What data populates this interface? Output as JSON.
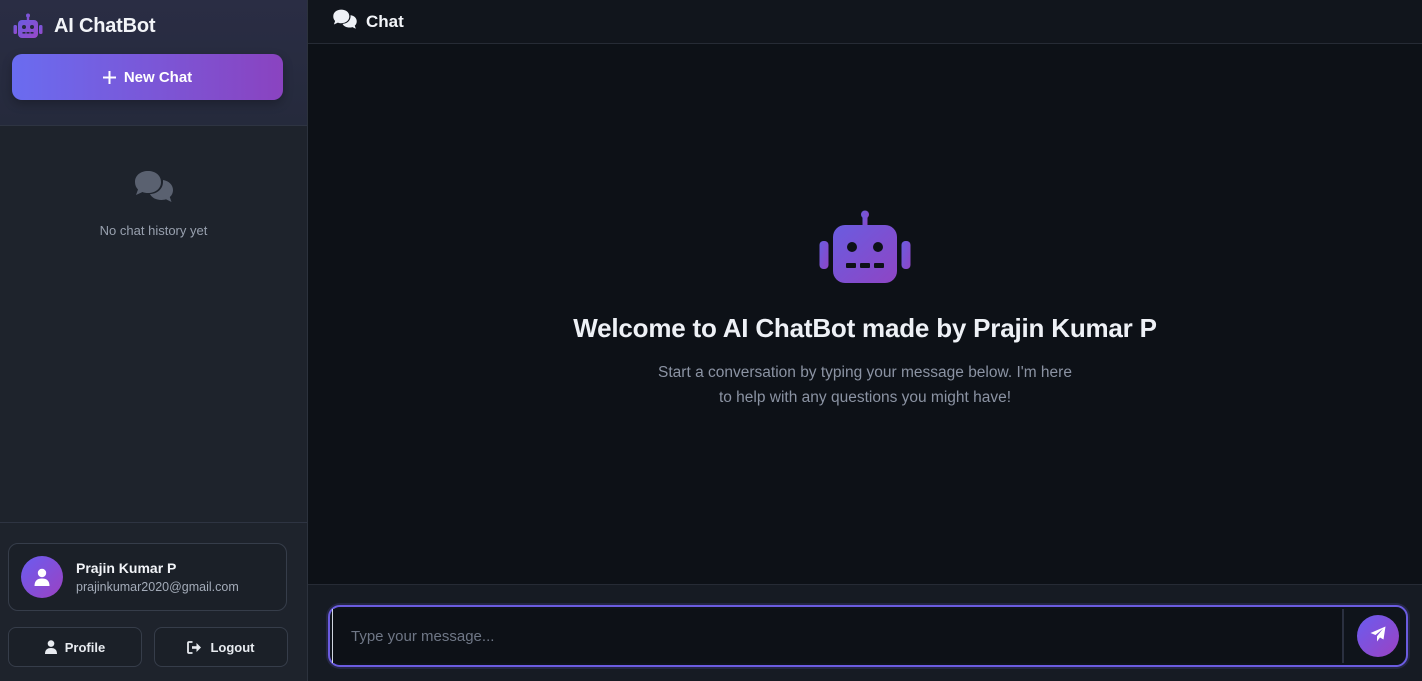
{
  "brand": {
    "title": "AI ChatBot",
    "icon": "robot-icon"
  },
  "sidebar": {
    "new_chat_label": "New Chat",
    "history_empty": "No chat history yet",
    "user": {
      "name": "Prajin Kumar P",
      "email": "prajinkumar2020@gmail.com"
    },
    "profile_label": "Profile",
    "logout_label": "Logout"
  },
  "header": {
    "title": "Chat",
    "icon": "comments-icon"
  },
  "welcome": {
    "title": "Welcome to AI ChatBot made by Prajin Kumar P",
    "subtitle": "Start a conversation by typing your message below. I'm here to help with any questions you might have!"
  },
  "composer": {
    "placeholder": "Type your message...",
    "value": "",
    "send_icon": "paper-plane-icon"
  },
  "colors": {
    "accent_start": "#6a6cf0",
    "accent_end": "#8a43c0",
    "robot": "#7b55d6"
  }
}
